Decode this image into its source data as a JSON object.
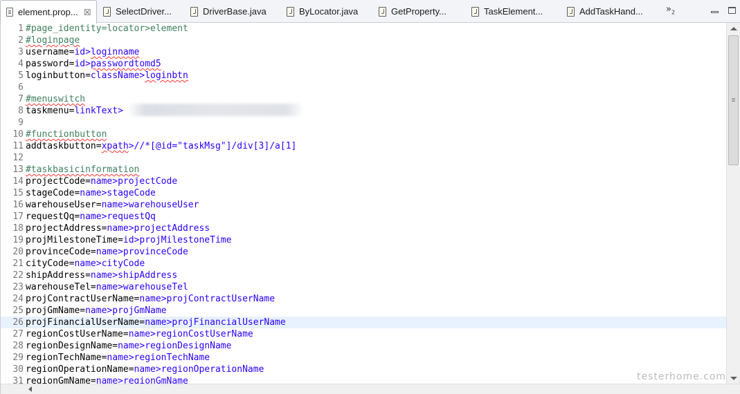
{
  "tabs": [
    {
      "label": "element.prop...",
      "icon": "properties-file-icon",
      "active": true,
      "closable": true
    },
    {
      "label": "SelectDriver...",
      "icon": "java-file-icon"
    },
    {
      "label": "DriverBase.java",
      "icon": "java-file-icon"
    },
    {
      "label": "ByLocator.java",
      "icon": "java-file-icon"
    },
    {
      "label": "GetProperty...",
      "icon": "java-file-icon"
    },
    {
      "label": "TaskElement...",
      "icon": "java-file-icon"
    },
    {
      "label": "AddTaskHand...",
      "icon": "java-file-icon"
    }
  ],
  "overflow": {
    "symbol": "»",
    "count": "2"
  },
  "close_symbol": "☒",
  "editor": {
    "lines": [
      {
        "num": "1",
        "type": "comment",
        "text": "#page_identity=locator>element"
      },
      {
        "num": "2",
        "type": "comment",
        "text": "#loginpage"
      },
      {
        "num": "3",
        "type": "kv",
        "key": "username",
        "by": "id",
        "value": "loginname"
      },
      {
        "num": "4",
        "type": "kv",
        "key": "password",
        "by": "id",
        "value": "passwordtomd5"
      },
      {
        "num": "5",
        "type": "kv",
        "key": "loginbutton",
        "by": "className",
        "value": "loginbtn"
      },
      {
        "num": "6",
        "type": "blank",
        "text": ""
      },
      {
        "num": "7",
        "type": "comment",
        "text": "#menuswitch"
      },
      {
        "num": "8",
        "type": "kv",
        "key": "taskmenu",
        "by": "linkText",
        "value": ""
      },
      {
        "num": "9",
        "type": "blank",
        "text": ""
      },
      {
        "num": "10",
        "type": "comment",
        "text": "#functionbutton"
      },
      {
        "num": "11",
        "type": "kv",
        "key": "addtaskbutton",
        "by": "xpath",
        "value": "//*[@id=\"taskMsg\"]/div[3]/a[1]"
      },
      {
        "num": "12",
        "type": "blank",
        "text": ""
      },
      {
        "num": "13",
        "type": "comment",
        "text": "#taskbasicinformation"
      },
      {
        "num": "14",
        "type": "kv",
        "key": "projectCode",
        "by": "name",
        "value": "projectCode"
      },
      {
        "num": "15",
        "type": "kv",
        "key": "stageCode",
        "by": "name",
        "value": "stageCode"
      },
      {
        "num": "16",
        "type": "kv",
        "key": "warehouseUser",
        "by": "name",
        "value": "warehouseUser"
      },
      {
        "num": "17",
        "type": "kv",
        "key": "requestQq",
        "by": "name",
        "value": "requestQq"
      },
      {
        "num": "18",
        "type": "kv",
        "key": "projectAddress",
        "by": "name",
        "value": "projectAddress"
      },
      {
        "num": "19",
        "type": "kv",
        "key": "projMilestoneTime",
        "by": "id",
        "value": "projMilestoneTime"
      },
      {
        "num": "20",
        "type": "kv",
        "key": "provinceCode",
        "by": "name",
        "value": "provinceCode"
      },
      {
        "num": "21",
        "type": "kv",
        "key": "cityCode",
        "by": "name",
        "value": "cityCode"
      },
      {
        "num": "22",
        "type": "kv",
        "key": "shipAddress",
        "by": "name",
        "value": "shipAddress"
      },
      {
        "num": "23",
        "type": "kv",
        "key": "warehouseTel",
        "by": "name",
        "value": "warehouseTel"
      },
      {
        "num": "24",
        "type": "kv",
        "key": "projContractUserName",
        "by": "name",
        "value": "projContractUserName"
      },
      {
        "num": "25",
        "type": "kv",
        "key": "projGmName",
        "by": "name",
        "value": "projGmName"
      },
      {
        "num": "26",
        "type": "kv",
        "key": "projFinancialUserName",
        "by": "name",
        "value": "projFinancialUserName",
        "current": true
      },
      {
        "num": "27",
        "type": "kv",
        "key": "regionCostUserName",
        "by": "name",
        "value": "regionCostUserName"
      },
      {
        "num": "28",
        "type": "kv",
        "key": "regionDesignName",
        "by": "name",
        "value": "regionDesignName"
      },
      {
        "num": "29",
        "type": "kv",
        "key": "regionTechName",
        "by": "name",
        "value": "regionTechName"
      },
      {
        "num": "30",
        "type": "kv",
        "key": "regionOperationName",
        "by": "name",
        "value": "regionOperationName"
      },
      {
        "num": "31",
        "type": "kv",
        "key": "regionGmName",
        "by": "name",
        "value": "regionGmName"
      }
    ]
  },
  "watermark": "testerhome.com",
  "colors": {
    "comment": "#3f7f5f",
    "value": "#2a00ff",
    "current_line": "#e8f2fe"
  }
}
